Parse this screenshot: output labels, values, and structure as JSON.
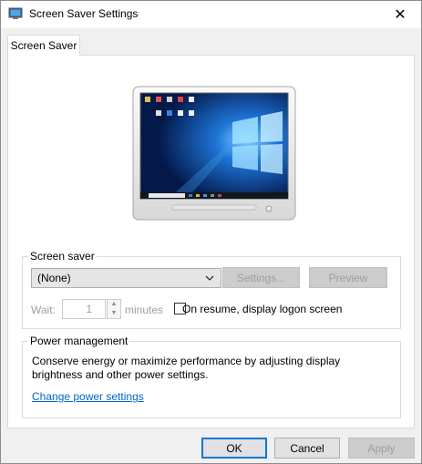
{
  "window": {
    "title": "Screen Saver Settings",
    "icon": "monitor-icon",
    "close_glyph": "✕"
  },
  "tabs": [
    {
      "label": "Screen Saver",
      "selected": true
    }
  ],
  "screen_saver": {
    "group_label": "Screen saver",
    "selected_saver": "(None)",
    "settings_label": "Settings...",
    "preview_label": "Preview",
    "wait_label": "Wait:",
    "wait_value": "1",
    "minutes_label": "minutes",
    "resume_label": "On resume, display logon screen",
    "resume_checked": false
  },
  "power": {
    "group_label": "Power management",
    "description": "Conserve energy or maximize performance by adjusting display brightness and other power settings.",
    "link_label": "Change power settings"
  },
  "footer": {
    "ok_label": "OK",
    "cancel_label": "Cancel",
    "apply_label": "Apply"
  },
  "colors": {
    "accent": "#0078d7",
    "link": "#0066cc",
    "wallpaper": "#0a3d8f"
  }
}
